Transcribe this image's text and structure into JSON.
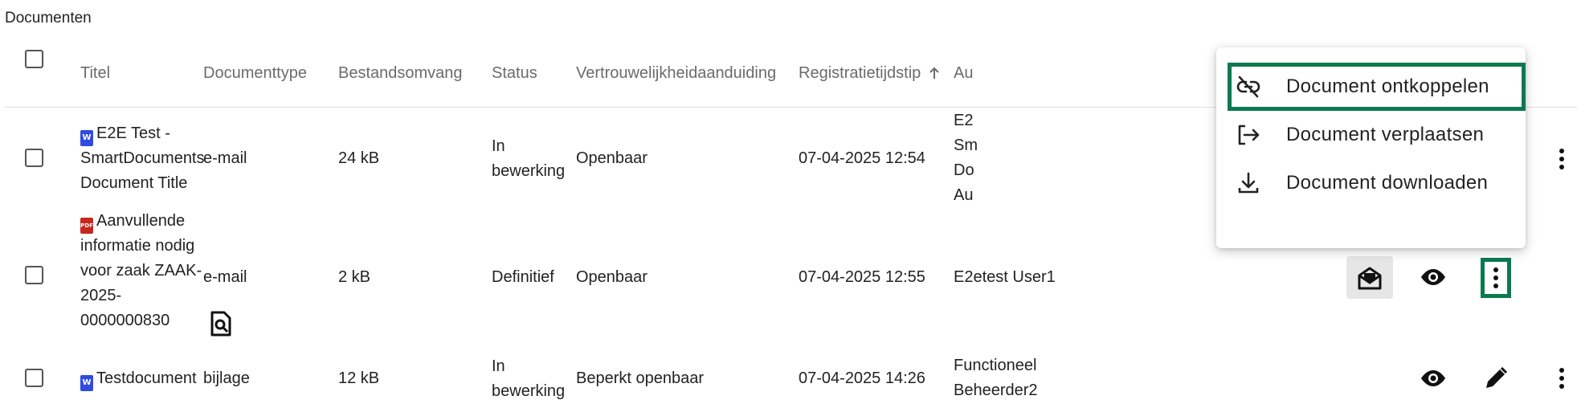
{
  "section": {
    "title": "Documenten"
  },
  "table": {
    "columns": [
      "Titel",
      "Documenttype",
      "Bestandsomvang",
      "Status",
      "Vertrouwelijkheidaanduiding",
      "Registratietijdstip",
      "Au"
    ],
    "sort": {
      "column": "Registratietijdstip",
      "direction": "ascending"
    },
    "rows": [
      {
        "title_lines": [
          "E2E Test -",
          "SmartDocuments",
          "Document Title"
        ],
        "file_icon": "word-file-icon",
        "type": "e-mail",
        "size": "24 kB",
        "status_lines": [
          "In",
          "bewerking"
        ],
        "confidentiality": "Openbaar",
        "registered": "07-04-2025 12:54",
        "author_lines": [
          "E2",
          "Sm",
          "Do",
          "Au"
        ]
      },
      {
        "title_lines": [
          "Aanvullende",
          "informatie nodig",
          "voor zaak ZAAK-",
          "2025-",
          "0000000830"
        ],
        "file_icon": "pdf-file-icon",
        "type": "e-mail",
        "size": "2 kB",
        "status_lines": [
          "Definitief"
        ],
        "confidentiality": "Openbaar",
        "registered": "07-04-2025 12:55",
        "author_lines": [
          "E2etest User1"
        ]
      },
      {
        "title_lines": [
          "Testdocument"
        ],
        "file_icon": "word-file-icon",
        "type": "bijlage",
        "size": "12 kB",
        "status_lines": [
          "In",
          "bewerking"
        ],
        "confidentiality": "Beperkt openbaar",
        "registered": "07-04-2025 14:26",
        "author_lines": [
          "Functioneel",
          "Beheerder2"
        ]
      }
    ]
  },
  "context_menu": {
    "items": [
      {
        "label": "Document ontkoppelen",
        "icon": "unlink-icon",
        "focused": true
      },
      {
        "label": "Document verplaatsen",
        "icon": "move-icon",
        "focused": false
      },
      {
        "label": "Document downloaden",
        "icon": "download-icon",
        "focused": false
      }
    ]
  },
  "colors": {
    "focus_outline": "#0a7a4f",
    "word_icon": "#2f4be0",
    "pdf_icon": "#c8251f",
    "header_text": "#6b6b6b"
  },
  "icons": {
    "word_label": "W",
    "pdf_label": "PDF"
  }
}
